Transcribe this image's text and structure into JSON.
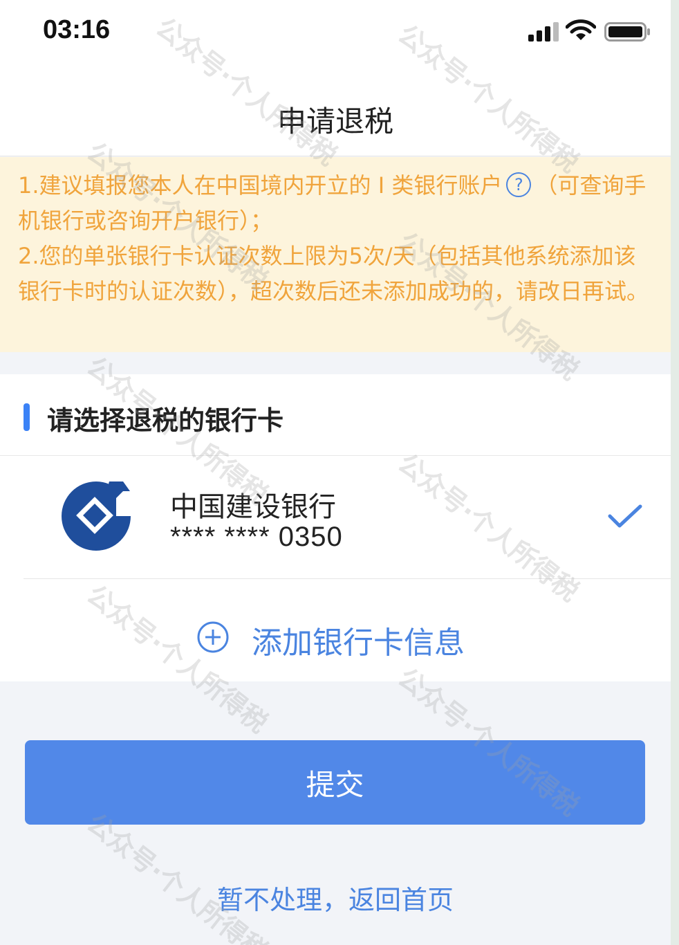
{
  "status_bar": {
    "time": "03:16",
    "icons": [
      "signal-icon",
      "wifi-icon",
      "battery-icon"
    ]
  },
  "header": {
    "title": "申请退税"
  },
  "notice": {
    "line1_before_icon": "1.建议填报您本人在中国境内开立的 I 类银行账户",
    "help_icon": "?",
    "line1_after_icon": "（可查询手机银行或咨询开户银行）；",
    "line2": "2.您的单张银行卡认证次数上限为5次/天（包括其他系统添加该银行卡时的认证次数），超次数后还未添加成功的，请改日再试。"
  },
  "card_section": {
    "title": "请选择退税的银行卡",
    "bank": {
      "name": "中国建设银行",
      "number": "**** **** 0350",
      "selected": true
    },
    "add_card_label": "添加银行卡信息"
  },
  "actions": {
    "submit_label": "提交",
    "skip_label": "暂不处理，返回首页"
  },
  "watermark": {
    "text": "公众号·个人所得税"
  },
  "colors": {
    "accent": "#4a84e0",
    "button": "#5188e8",
    "notice_bg": "#fdf4dc",
    "notice_text": "#f0a43c",
    "bank_logo": "#1f4e9c"
  }
}
